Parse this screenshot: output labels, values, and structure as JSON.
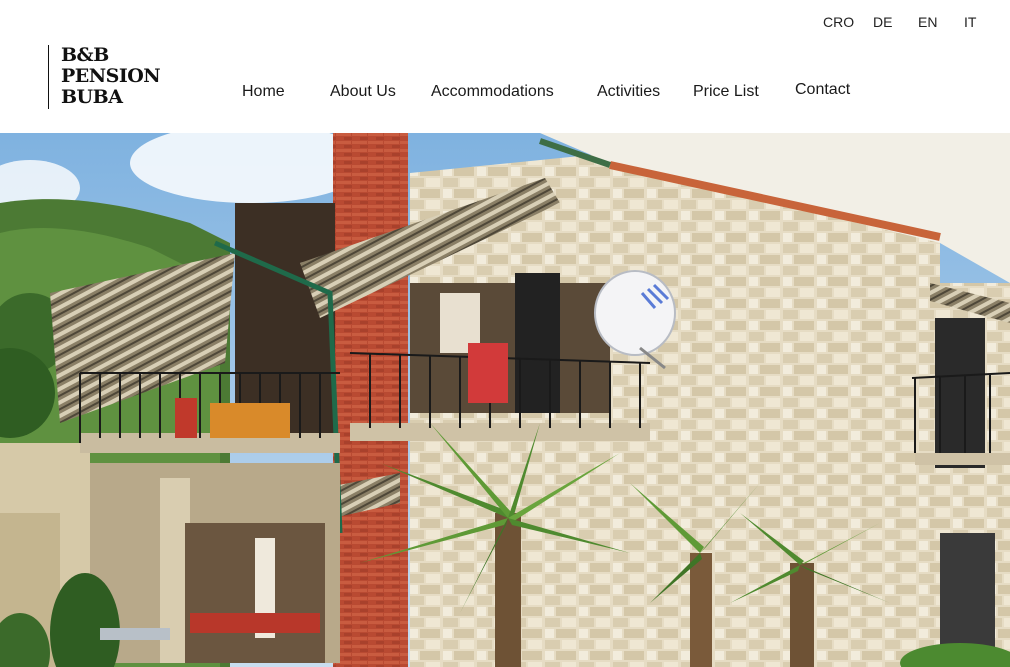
{
  "languages": [
    "CRO",
    "DE",
    "EN",
    "IT"
  ],
  "logo": {
    "line1": "B&B",
    "line2": "PENSION",
    "line3": "BUBA"
  },
  "nav": {
    "home": "Home",
    "about": "About Us",
    "accommodations": "Accommodations",
    "activities": "Activities",
    "price_list": "Price List",
    "contact": "Contact"
  },
  "hero": {
    "subject": "stone-house-with-awnings-balconies-and-palm-trees"
  },
  "colors": {
    "background": "#ffffff",
    "text": "#1a1a1a",
    "sky": "#9cc4e8",
    "stone": "#e8dfc9",
    "brick": "#c0533a",
    "awning": "#6e6553",
    "palm": "#4f8a2f"
  }
}
